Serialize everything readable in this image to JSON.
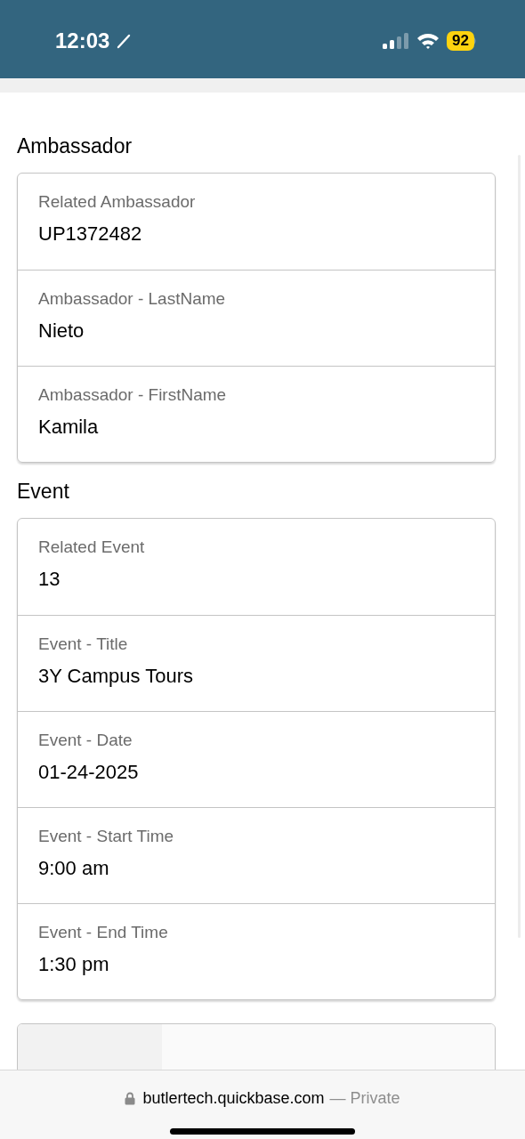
{
  "status_bar": {
    "time": "12:03",
    "battery": "92"
  },
  "sections": [
    {
      "title": "Ambassador",
      "fields": [
        {
          "label": "Related Ambassador",
          "value": "UP1372482"
        },
        {
          "label": "Ambassador - LastName",
          "value": "Nieto"
        },
        {
          "label": "Ambassador - FirstName",
          "value": "Kamila"
        }
      ]
    },
    {
      "title": "Event",
      "fields": [
        {
          "label": "Related Event",
          "value": "13"
        },
        {
          "label": "Event - Title",
          "value": "3Y Campus Tours"
        },
        {
          "label": "Event - Date",
          "value": "01-24-2025"
        },
        {
          "label": "Event - Start Time",
          "value": "9:00 am"
        },
        {
          "label": "Event - End Time",
          "value": "1:30 pm"
        }
      ]
    }
  ],
  "browser_bar": {
    "domain": "butlertech.quickbase.com",
    "mode": "— Private"
  }
}
